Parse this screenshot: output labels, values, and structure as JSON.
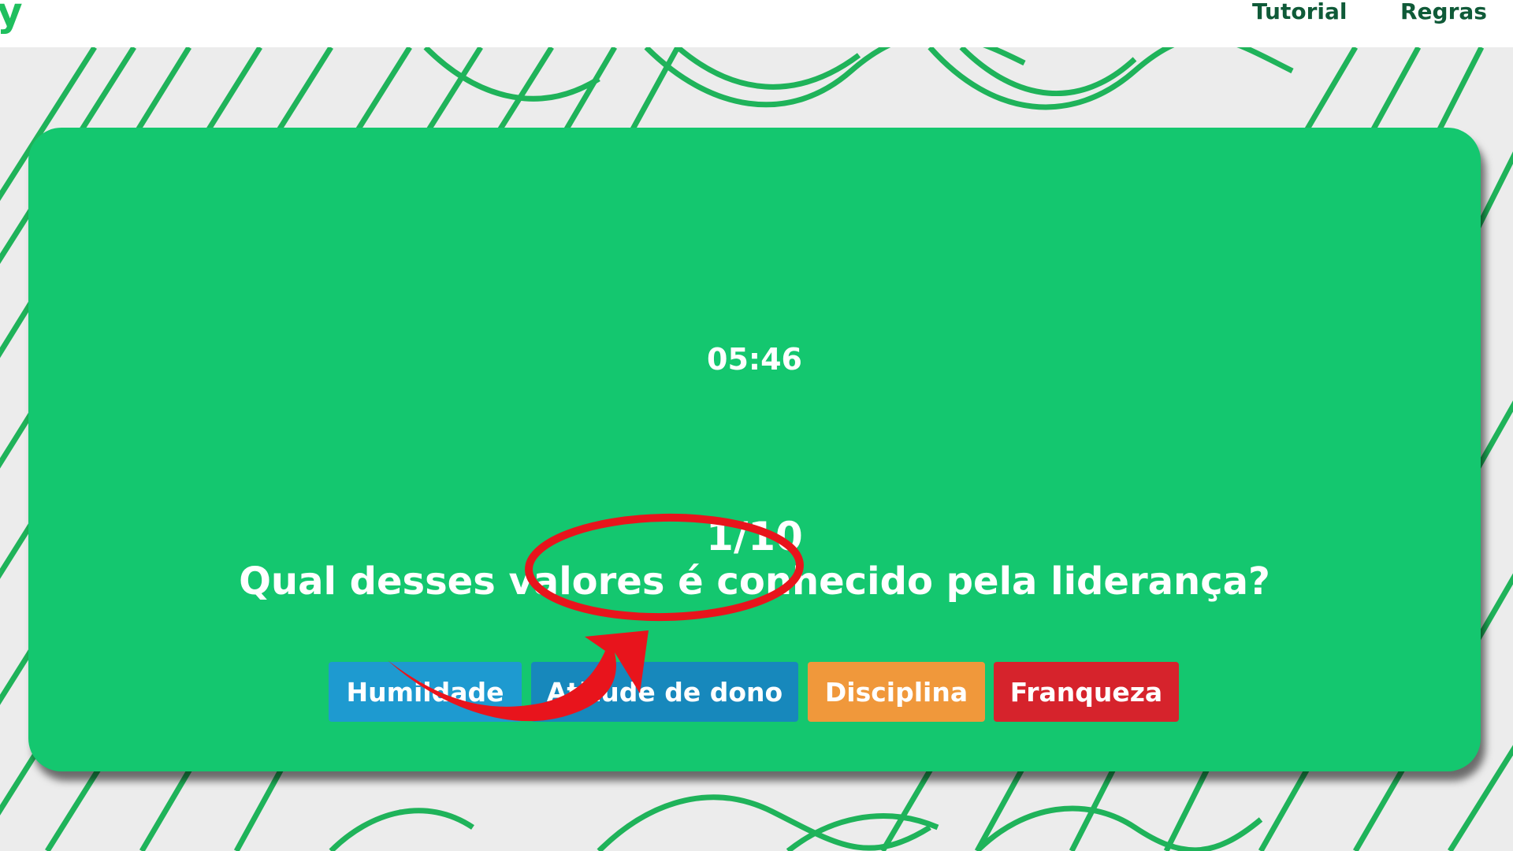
{
  "header": {
    "logo_fragment": "y",
    "nav": [
      {
        "label": "Tutorial"
      },
      {
        "label": "Regras"
      }
    ]
  },
  "quiz": {
    "timer": "05:46",
    "progress": "1/10",
    "question": "Qual desses valores é conhecido pela liderança?",
    "options": [
      {
        "label": "Humildade",
        "color": "#1e9ad0"
      },
      {
        "label": "Atitude de dono",
        "color": "#1788bc"
      },
      {
        "label": "Disciplina",
        "color": "#f0983b"
      },
      {
        "label": "Franqueza",
        "color": "#d6232c"
      }
    ]
  },
  "colors": {
    "brand_green": "#14c76f",
    "header_text": "#0f5a38",
    "annotation_red": "#e8141c",
    "pattern_line": "#1fb35a"
  }
}
